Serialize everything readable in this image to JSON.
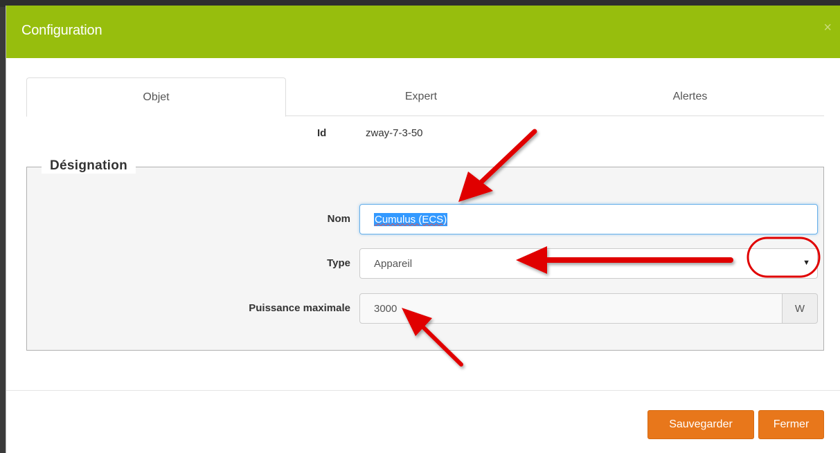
{
  "modal": {
    "title": "Configuration",
    "close_glyph": "×"
  },
  "tabs": [
    {
      "label": "Objet",
      "active": true
    },
    {
      "label": "Expert",
      "active": false
    },
    {
      "label": "Alertes",
      "active": false
    }
  ],
  "id_row": {
    "label": "Id",
    "value": "zway-7-3-50"
  },
  "fieldset": {
    "legend": "Désignation",
    "nom": {
      "label": "Nom",
      "value": "Cumulus (ECS)"
    },
    "type": {
      "label": "Type",
      "value": "Appareil",
      "caret": "▼"
    },
    "puissance": {
      "label": "Puissance maximale",
      "value": "3000",
      "unit": "W"
    }
  },
  "footer": {
    "save_label": "Sauvegarder",
    "close_label": "Fermer"
  },
  "colors": {
    "header": "#97be0d",
    "button": "#e8771b",
    "annotation": "#e00000"
  },
  "icons": [
    "close-icon",
    "caret-down-icon",
    "annotation-arrow-icon",
    "annotation-circle-icon"
  ]
}
